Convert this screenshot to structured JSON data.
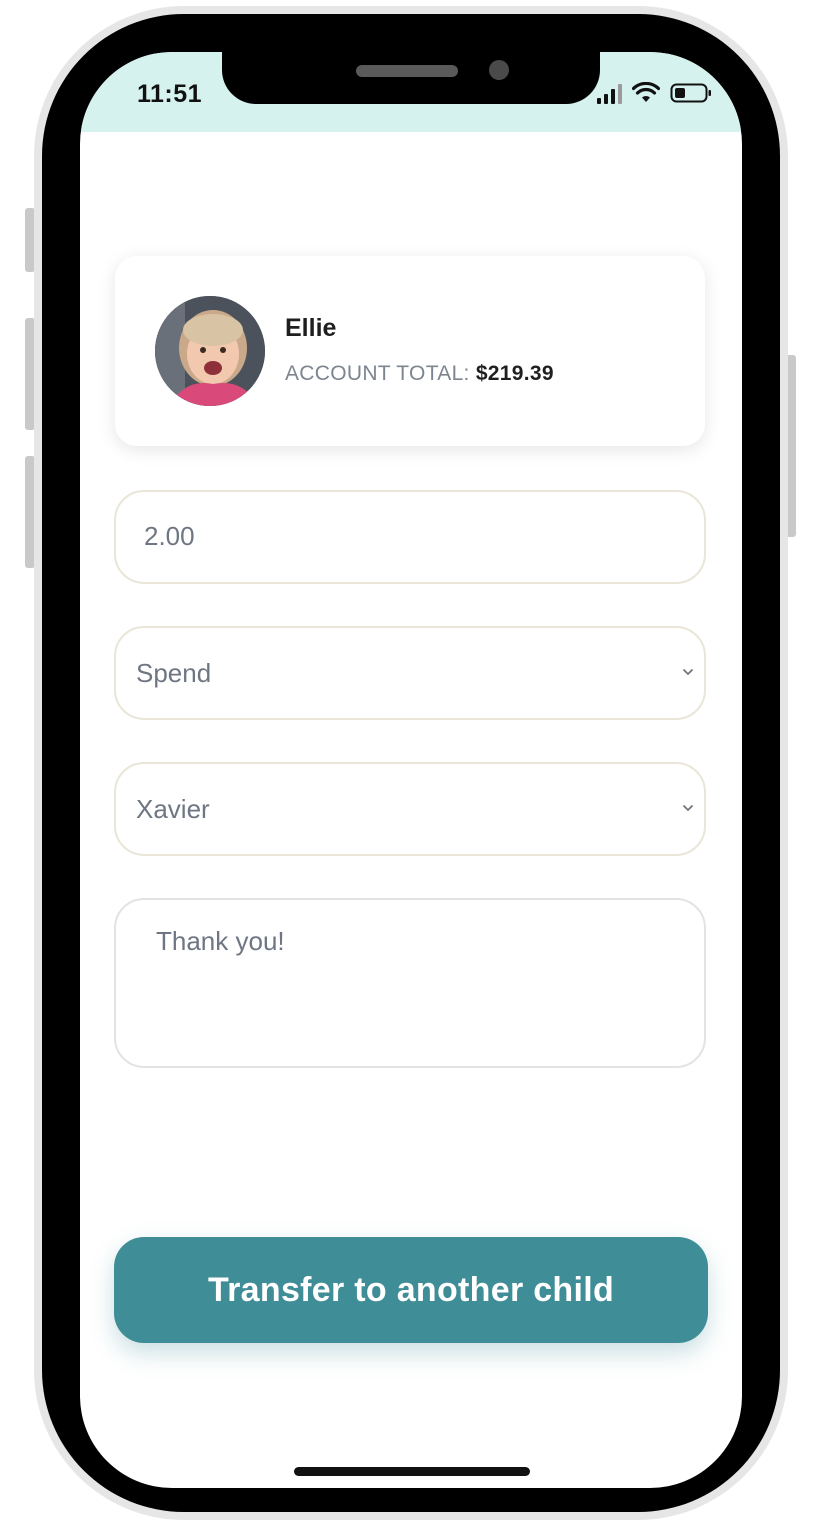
{
  "status_bar": {
    "time": "11:51",
    "background": "#d6f2ee",
    "icons": [
      "signal-icon",
      "wifi-icon",
      "battery-icon"
    ]
  },
  "profile": {
    "name": "Ellie",
    "account_total_label": "ACCOUNT TOTAL:",
    "account_total_value": "$219.39"
  },
  "form": {
    "amount_value": "2.00",
    "account_type_selected": "Spend",
    "recipient_selected": "Xavier",
    "note_value": "Thank you!"
  },
  "actions": {
    "transfer_label": "Transfer to another child"
  },
  "colors": {
    "accent": "#3f8d97",
    "field_border": "#e9e6d8"
  }
}
